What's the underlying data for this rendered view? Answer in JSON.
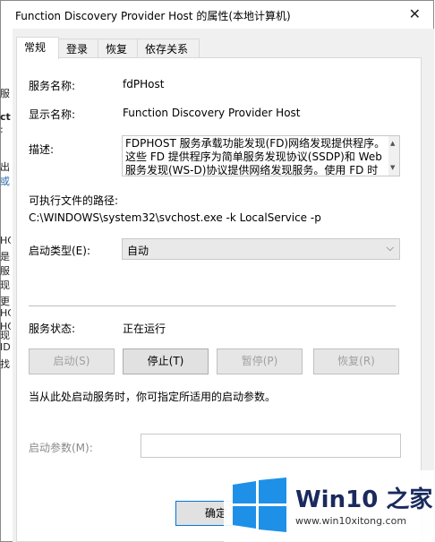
{
  "window": {
    "title": "Function Discovery Provider Host 的属性(本地计算机)"
  },
  "tabs": [
    "常规",
    "登录",
    "恢复",
    "依存关系"
  ],
  "general": {
    "service_name_label": "服务名称:",
    "service_name": "fdPHost",
    "display_name_label": "显示名称:",
    "display_name": "Function Discovery Provider Host",
    "description_label": "描述:",
    "description_lines": [
      "FDPHOST 服务承载功能发现(FD)网络发现提供程序。",
      "这些 FD 提供程序为简单服务发现协议(SSDP)和 Web",
      "服务发现(WS-D)协议提供网络发现服务。使用 FD 时"
    ],
    "path_label": "可执行文件的路径:",
    "path": "C:\\WINDOWS\\system32\\svchost.exe -k LocalService -p",
    "startup_type_label": "启动类型(E):",
    "startup_type": "自动",
    "status_label": "服务状态:",
    "status": "正在运行",
    "buttons": {
      "start": "启动(S)",
      "stop": "停止(T)",
      "pause": "暂停(P)",
      "resume": "恢复(R)"
    },
    "hint": "当从此处启动服务时，你可指定所适用的启动参数。",
    "params_label": "启动参数(M):",
    "params_value": ""
  },
  "footer": {
    "ok": "确定"
  },
  "background_fragments": [
    "服",
    "ct",
    ":",
    "出",
    "或",
    "HC",
    "是",
    "服",
    "现",
    "HC",
    "更",
    "HC",
    "现",
    "ID",
    "找"
  ],
  "watermark": {
    "title": "Win10 之家",
    "url": "www.win10xitong.com"
  },
  "colors": {
    "panel": "#ffffff",
    "dialog_bg": "#f0f0f0",
    "accent": "#0078d7",
    "logo": "#1e90e8"
  }
}
